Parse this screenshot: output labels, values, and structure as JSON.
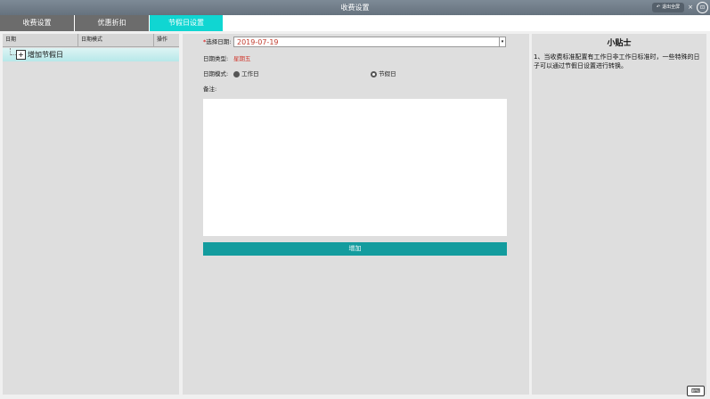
{
  "window": {
    "title": "收费设置",
    "exit_fullscreen_label": "退出全屏",
    "close_glyph": "×",
    "menu_glyph": "⊡"
  },
  "tabs": [
    {
      "label": "收费设置",
      "active": false
    },
    {
      "label": "优惠折扣",
      "active": false
    },
    {
      "label": "节假日设置",
      "active": true
    }
  ],
  "holiday_list": {
    "columns": [
      "日期",
      "日期模式",
      "操作"
    ],
    "tree_node": {
      "expander": "+",
      "label": "增加节假日"
    }
  },
  "form": {
    "required_mark": "*",
    "date_label": "选择日期:",
    "date_value": "2019-07-19",
    "date_type_label": "日期类型:",
    "date_type_value": "星期五",
    "date_mode_label": "日期模式:",
    "mode_options": [
      {
        "label": "工作日",
        "selected": false
      },
      {
        "label": "节假日",
        "selected": true
      }
    ],
    "remark_label": "备注:",
    "remark_value": "",
    "add_button_label": "增加"
  },
  "tips": {
    "title": "小贴士",
    "text": "1、当收费标准配置有工作日非工作日标准时，一些特殊的日子可以通过节假日设置进行转换。"
  },
  "colors": {
    "accent": "#10d6d2",
    "button": "#139c9e",
    "tab_inactive": "#6c6c6c",
    "titlebar": "#6f7b87",
    "date_text": "#c0392b"
  },
  "icons": [
    "exit-fullscreen-icon",
    "close-icon",
    "menu-icon",
    "tree-expand-icon",
    "dropdown-arrow-icon",
    "keyboard-icon"
  ]
}
